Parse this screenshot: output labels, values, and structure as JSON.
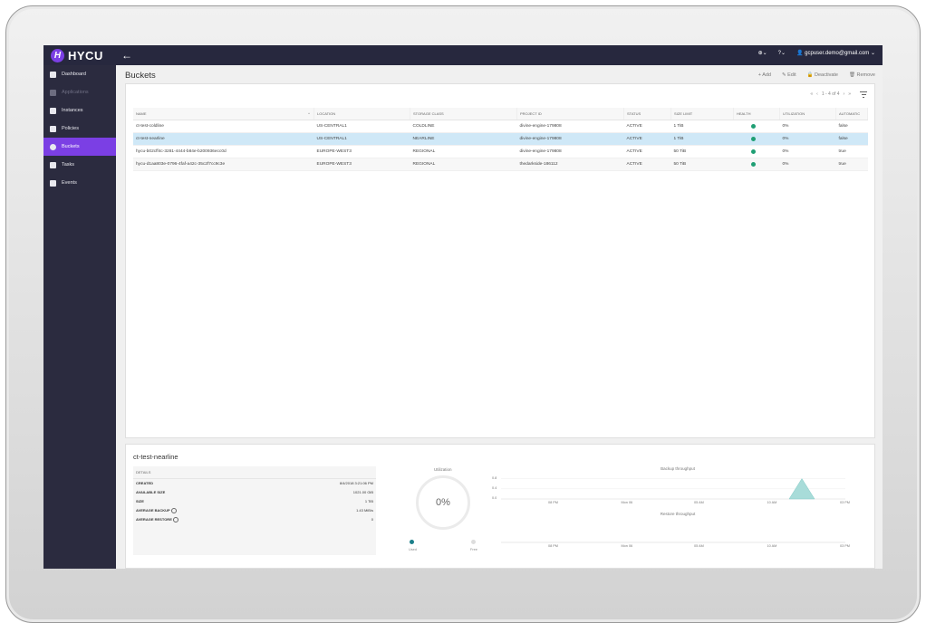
{
  "app": {
    "logo_text": "HYCU",
    "logo_letter": "H"
  },
  "topbar": {
    "back": "←",
    "globe": "⊕⌄",
    "help": "?⌄",
    "user": "gcpuser.demo@gmail.com ⌄"
  },
  "sidebar": {
    "items": [
      {
        "label": "Dashboard",
        "state": "normal"
      },
      {
        "label": "Applications",
        "state": "disabled"
      },
      {
        "label": "Instances",
        "state": "normal"
      },
      {
        "label": "Policies",
        "state": "normal"
      },
      {
        "label": "Buckets",
        "state": "active"
      },
      {
        "label": "Tasks",
        "state": "normal"
      },
      {
        "label": "Events",
        "state": "normal"
      }
    ]
  },
  "page": {
    "title": "Buckets"
  },
  "actions": {
    "add": "+ Add",
    "edit": "✎ Edit",
    "deactivate": "🔒 Deactivate",
    "remove": "🗑 Remove"
  },
  "pager": {
    "first": "«",
    "prev": "‹",
    "range": "1 - 4 of 4",
    "next": "›",
    "last": "»"
  },
  "table": {
    "columns": [
      "NAME",
      "LOCATION",
      "STORAGE CLASS",
      "PROJECT ID",
      "STATUS",
      "SIZE LIMIT",
      "HEALTH",
      "UTILIZATION",
      "AUTOMATIC"
    ],
    "sort_indicator": "^",
    "rows": [
      {
        "name": "ct-test-coldline",
        "location": "US-CENTRAL1",
        "storage_class": "COLDLINE",
        "project_id": "divine-engine-179808",
        "status": "ACTIVE",
        "size_limit": "1 TiB",
        "utilization": "0%",
        "automatic": "false"
      },
      {
        "name": "ct-test-nearline",
        "location": "US-CENTRAL1",
        "storage_class": "NEARLINE",
        "project_id": "divine-engine-179808",
        "status": "ACTIVE",
        "size_limit": "1 TiB",
        "utilization": "0%",
        "automatic": "false"
      },
      {
        "name": "hycu-b02cff4c-3281-4444-b84e-b200936ecc0d",
        "location": "EUROPE-WEST3",
        "storage_class": "REGIONAL",
        "project_id": "divine-engine-179808",
        "status": "ACTIVE",
        "size_limit": "50 TiB",
        "utilization": "0%",
        "automatic": "true"
      },
      {
        "name": "hycu-d1aa803e-0796-4faf-a42c-35c2f7cc9c3e",
        "location": "EUROPE-WEST3",
        "storage_class": "REGIONAL",
        "project_id": "thedarkside-186112",
        "status": "ACTIVE",
        "size_limit": "50 TiB",
        "utilization": "0%",
        "automatic": "true"
      }
    ],
    "selected_index": 1
  },
  "details": {
    "title": "ct-test-nearline",
    "header": "DETAILS",
    "rows": [
      {
        "key": "CREATED",
        "value": "8/4/2018 3:21:06 PM"
      },
      {
        "key": "AVAILABLE SIZE",
        "value": "1021.00 GiB"
      },
      {
        "key": "SIZE",
        "value": "1 TiB"
      },
      {
        "key": "AVERAGE BACKUP",
        "value": "1.43 MiB/s"
      },
      {
        "key": "AVERAGE RESTORE",
        "value": "0"
      }
    ]
  },
  "utilization": {
    "title": "Utilization",
    "value": "0%",
    "used_label": "Used",
    "free_label": "Free"
  },
  "chart_data": [
    {
      "type": "area",
      "title": "Backup throughput",
      "x": [
        "08 PM",
        "Mon 06",
        "05 AM",
        "10 AM",
        "03 PM"
      ],
      "y_ticks": [
        "0.8",
        "0.4",
        "0.0"
      ],
      "ylim": [
        0,
        1
      ],
      "series": [
        {
          "values": [
            0,
            0,
            0,
            0,
            0.8,
            0
          ]
        }
      ]
    },
    {
      "type": "area",
      "title": "Restore throughput",
      "x": [
        "08 PM",
        "Mon 06",
        "05 AM",
        "10 AM",
        "03 PM"
      ],
      "series": [
        {
          "values": []
        }
      ]
    }
  ],
  "colors": {
    "accent": "#7b3fe4",
    "sidebar": "#2b2b3f",
    "health": "#1f9f74",
    "selected_row": "#cfe8f7",
    "chart_fill": "#a8dcd9"
  }
}
